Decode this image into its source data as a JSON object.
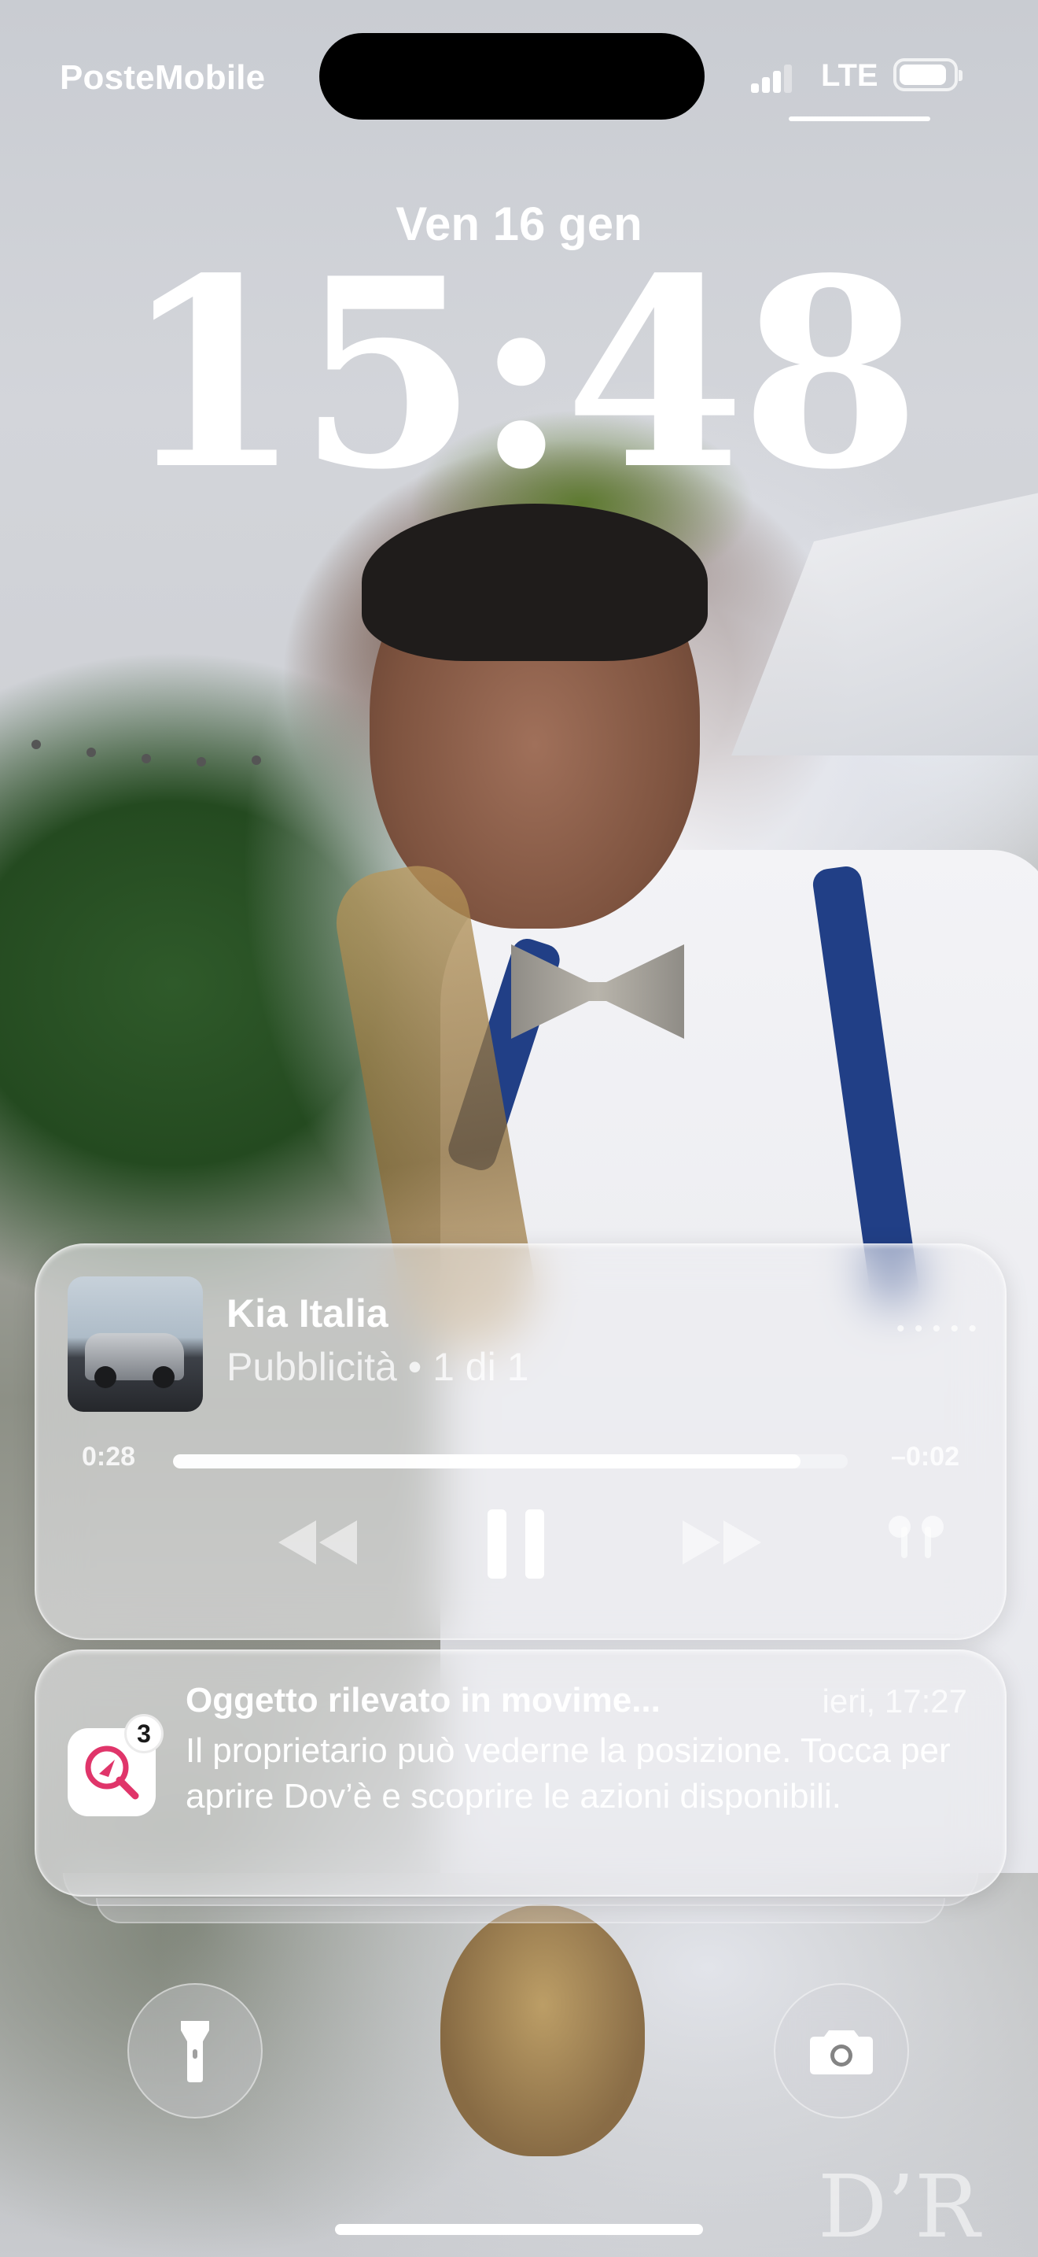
{
  "status_bar": {
    "carrier": "PosteMobile",
    "network": "LTE",
    "signal_bars": 3,
    "signal_bars_total": 4,
    "battery_level": 0.9
  },
  "lock_screen": {
    "date": "Ven 16 gen",
    "time": "15:48"
  },
  "now_playing": {
    "title": "Kia Italia",
    "subtitle": "Pubblicità • 1 di 1",
    "elapsed": "0:28",
    "remaining": "–0:02",
    "progress": 0.93,
    "icons": {
      "rewind": "rewind-icon",
      "pause": "pause-icon",
      "fast_forward": "fast-forward-icon",
      "output": "airpods-icon",
      "more": "more-dots-icon"
    }
  },
  "notification": {
    "app_icon": "find-my-icon",
    "badge_count": "3",
    "title": "Oggetto rilevato in movime...",
    "time": "ieri, 17:27",
    "body": "Il proprietario può vederne la posizione. Tocca per aprire Dov’è e scoprire le azioni disponibili."
  },
  "quick_actions": {
    "left_icon": "flashlight-icon",
    "right_icon": "camera-icon"
  },
  "colors": {
    "text": "#ffffff",
    "find_my_accent": "#e0356a"
  }
}
